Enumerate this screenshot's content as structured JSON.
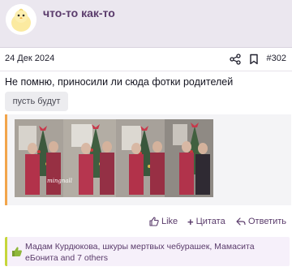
{
  "post": {
    "username": "что-то как-то",
    "date": "24 Дек 2024",
    "number": "#302",
    "text": "Не помню, приносили ли сюда фотки родителей",
    "reply_label": "пусть будут",
    "photo_caption": "mingnall"
  },
  "actions": {
    "like": "Like",
    "quote": "Цитата",
    "reply": "Ответить"
  },
  "likes": {
    "text": "Мадам Курдюкова, шкуры мертвых чебурашек, Мамасита еБонита and 7 others"
  },
  "colors": {
    "accent": "#5a3b6b",
    "quote_border": "#f2a54b",
    "likes_border": "#c6d63a"
  },
  "icons": [
    "chick-avatar",
    "share-icon",
    "bookmark-icon",
    "like-icon",
    "plus-icon",
    "reply-icon",
    "thumbs-up-icon"
  ]
}
